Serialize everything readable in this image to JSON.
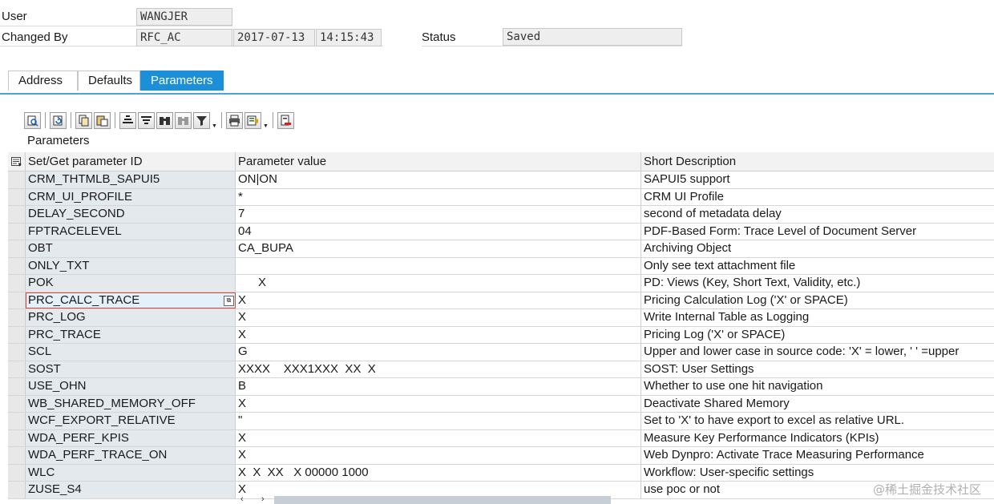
{
  "header": {
    "user_label": "User",
    "user_value": "WANGJER",
    "changed_by_label": "Changed By",
    "changed_by_value": "RFC_AC",
    "changed_date": "2017-07-13",
    "changed_time": "14:15:43",
    "status_label": "Status",
    "status_value": "Saved"
  },
  "tabs": [
    {
      "label": "Address",
      "active": false
    },
    {
      "label": "Defaults",
      "active": false
    },
    {
      "label": "Parameters",
      "active": true
    }
  ],
  "toolbar_icons": [
    "details-icon",
    "refresh-icon",
    "copy-icon",
    "paste-icon",
    "sort-ascending-icon",
    "sort-descending-icon",
    "find-icon",
    "find-next-icon",
    "filter-icon",
    "print-icon",
    "export-icon",
    "delete-row-icon"
  ],
  "section_title": "Parameters",
  "grid": {
    "columns": [
      "Set/Get parameter ID",
      "Parameter value",
      "Short Description"
    ],
    "rows": [
      {
        "id": "CRM_THTMLB_SAPUI5",
        "value": "ON|ON",
        "desc": "SAPUI5 support"
      },
      {
        "id": "CRM_UI_PROFILE",
        "value": "*",
        "desc": "CRM UI Profile"
      },
      {
        "id": "DELAY_SECOND",
        "value": "7",
        "desc": "second of metadata delay"
      },
      {
        "id": "FPTRACELEVEL",
        "value": "04",
        "desc": "PDF-Based Form: Trace Level of Document Server"
      },
      {
        "id": "OBT",
        "value": "CA_BUPA",
        "desc": "Archiving Object"
      },
      {
        "id": "ONLY_TXT",
        "value": "",
        "desc": "Only see text attachment file"
      },
      {
        "id": "POK",
        "value": "      X",
        "desc": "PD: Views (Key, Short Text, Validity, etc.)"
      },
      {
        "id": "PRC_CALC_TRACE",
        "value": "X",
        "desc": "Pricing Calculation Log ('X' or SPACE)"
      },
      {
        "id": "PRC_LOG",
        "value": "X",
        "desc": "Write Internal Table as Logging"
      },
      {
        "id": "PRC_TRACE",
        "value": "X",
        "desc": "Pricing Log ('X' or SPACE)"
      },
      {
        "id": "SCL",
        "value": "G",
        "desc": "Upper and lower case in source code: 'X' = lower, ' ' =upper"
      },
      {
        "id": "SOST",
        "value": "XXXX    XXX1XXX  XX  X",
        "desc": "SOST: User Settings"
      },
      {
        "id": "USE_OHN",
        "value": "B",
        "desc": "Whether to use one hit navigation"
      },
      {
        "id": "WB_SHARED_MEMORY_OFF",
        "value": "X",
        "desc": "Deactivate Shared Memory"
      },
      {
        "id": "WCF_EXPORT_RELATIVE",
        "value": "\"",
        "desc": "Set to 'X' to have export to excel as relative URL."
      },
      {
        "id": "WDA_PERF_KPIS",
        "value": "X",
        "desc": "Measure Key Performance Indicators (KPIs)"
      },
      {
        "id": "WDA_PERF_TRACE_ON",
        "value": "X",
        "desc": "Web Dynpro: Activate Trace Measuring Performance"
      },
      {
        "id": "WLC",
        "value": "X  X  XX   X 00000 1000",
        "desc": "Workflow: User-specific settings"
      },
      {
        "id": "ZUSE_S4",
        "value": "X",
        "desc": "use poc or not"
      }
    ],
    "selected_row": "PRC_CALC_TRACE"
  },
  "scrollbar": {
    "left_arrow": "‹",
    "right_arrow": "›"
  },
  "watermark": "@稀土掘金技术社区"
}
